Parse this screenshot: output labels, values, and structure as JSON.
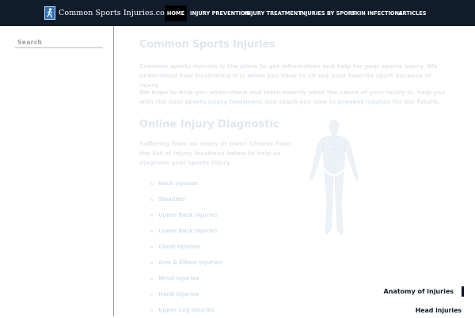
{
  "header": {
    "site_name": "Common Sports Injuries.com",
    "logo_icon": "runner-icon",
    "nav": [
      {
        "label": "HOME",
        "active": true
      },
      {
        "label": "INJURY PREVENTION",
        "active": false
      },
      {
        "label": "INJURY TREATMENT",
        "active": false
      },
      {
        "label": "INJURIES BY SPORT",
        "active": false
      },
      {
        "label": "SKIN INFECTIONS",
        "active": false
      },
      {
        "label": "ARTICLES",
        "active": false
      }
    ]
  },
  "sidebar": {
    "search_label": "Search",
    "section_title": "Anatomy of injuries",
    "first_item": "Head injuries"
  },
  "main": {
    "title": "Common Sports Injuries",
    "intro_p1": "Common sports injuries is the place to get information and help for your sports injury. We understand how frustrating it is when you have to sit out your favorite sport because of injury.",
    "intro_p2_start": "We hope to help you understand and learn exactly what the cause of your injury is, help you with the best ",
    "intro_p2_link1": "sports injury treatment",
    "intro_p2_mid": " and teach you how to ",
    "intro_p2_link2": "prevent injuries",
    "intro_p2_end": " for the future.",
    "diagnostic_title": "Online Injury Diagnostic",
    "diagnostic_intro": "Suffering from an injury or pain? Choose from the list of injury locations below to help us diagnose your sports injury.",
    "injury_locations": [
      "Neck injuries",
      "Shoulder",
      "Upper Back injuries",
      "Lower Back injuries",
      "Chest injuries",
      "Arm & Elbow injuries",
      "Wrist injuries",
      "Hand injuries",
      "Upper Leg injuries"
    ]
  },
  "colors": {
    "topbar": "#101c2c",
    "active_nav": "#000000",
    "sidebar_text": "#0c1826"
  }
}
